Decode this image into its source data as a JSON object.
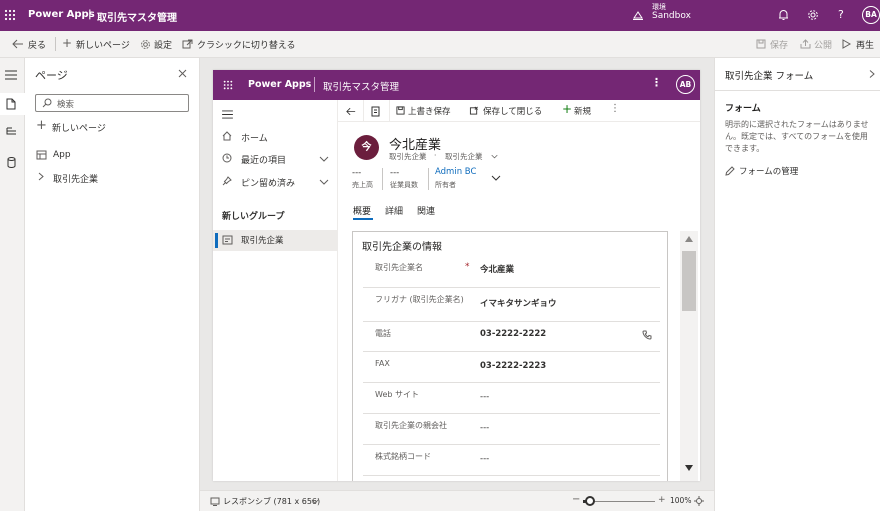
{
  "topbar": {
    "app_name": "Power Apps",
    "separator": "|",
    "title": "取引先マスタ管理",
    "env_label": "環境",
    "env_name": "Sandbox",
    "avatar": "BA"
  },
  "cmdbar": {
    "back": "戻る",
    "new_page": "新しいページ",
    "settings": "設定",
    "classic": "クラシックに切り替える",
    "save": "保存",
    "publish": "公開",
    "play": "再生"
  },
  "leftpane": {
    "title": "ページ",
    "search_placeholder": "検索",
    "new_page": "新しいページ",
    "tree": [
      {
        "label": "App"
      },
      {
        "label": "取引先企業"
      }
    ]
  },
  "app_header": {
    "app_name": "Power Apps",
    "title": "取引先マスタ管理",
    "avatar": "AB"
  },
  "sitemap": {
    "items": [
      {
        "label": "ホーム"
      },
      {
        "label": "最近の項目"
      },
      {
        "label": "ピン留め済み"
      }
    ],
    "group": "新しいグループ",
    "entity": "取引先企業"
  },
  "form_cmd": {
    "save_over": "上書き保存",
    "save_close": "保存して閉じる",
    "new": "新規"
  },
  "record": {
    "initial": "今",
    "name": "今北産業",
    "entity": "取引先企業",
    "form_name": "取引先企業",
    "kpis": [
      {
        "value": "---",
        "label": "売上高"
      },
      {
        "value": "---",
        "label": "従業員数"
      },
      {
        "value": "Admin BC",
        "label": "所有者"
      }
    ]
  },
  "tabs": [
    "概要",
    "詳細",
    "関連"
  ],
  "section": {
    "title": "取引先企業の情報",
    "required_mark": "*",
    "fields": [
      {
        "label": "取引先企業名",
        "value": "今北産業"
      },
      {
        "label": "フリガナ (取引先企業名)",
        "value": "イマキタサンギョウ"
      },
      {
        "label": "電話",
        "value": "03-2222-2222"
      },
      {
        "label": "FAX",
        "value": "03-2222-2223"
      },
      {
        "label": "Web サイト",
        "value": "---"
      },
      {
        "label": "取引先企業の親会社",
        "value": "---"
      },
      {
        "label": "株式銘柄コード",
        "value": "---"
      }
    ]
  },
  "statusbar": {
    "layout": "レスポンシブ (781 x 656)",
    "zoom_minus": "−",
    "zoom_plus": "+",
    "zoom": "100%",
    "zoom_fraction": 0.1
  },
  "rightpane": {
    "title": "取引先企業 フォーム",
    "section": "フォーム",
    "description": "明示的に選択されたフォームはありません。既定では、すべてのフォームを使用できます。",
    "manage": "フォームの管理"
  }
}
